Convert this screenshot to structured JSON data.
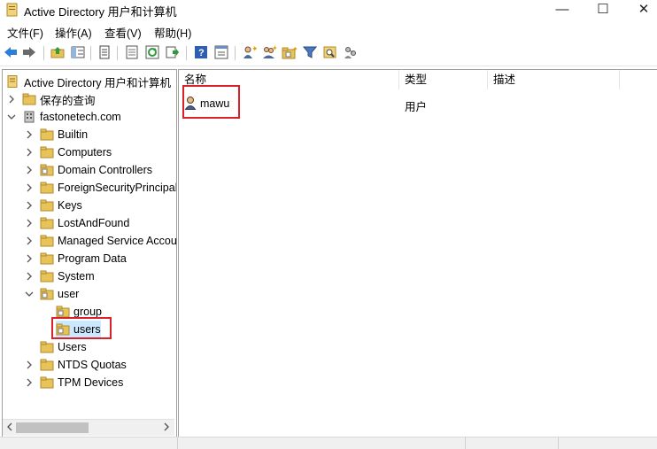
{
  "window": {
    "title": "Active Directory 用户和计算机",
    "controls": {
      "minimize": "—",
      "maximize": "☐",
      "close": "✕"
    }
  },
  "menu": [
    "文件(F)",
    "操作(A)",
    "查看(V)",
    "帮助(H)"
  ],
  "toolbar": {
    "icons": [
      "back-arrow-icon",
      "forward-arrow-icon",
      "up-folder-icon",
      "show-tree-icon",
      "copy-icon",
      "export-list-icon",
      "refresh-icon",
      "export-icon",
      "help-icon",
      "properties-icon",
      "new-user-icon",
      "new-group-icon",
      "new-ou-icon",
      "filter-icon",
      "find-icon",
      "delegate-icon"
    ]
  },
  "tree": {
    "root": "Active Directory 用户和计算机",
    "saved_queries": "保存的查询",
    "domain": "fastonetech.com",
    "children": [
      "Builtin",
      "Computers",
      "Domain Controllers",
      "ForeignSecurityPrincipals",
      "Keys",
      "LostAndFound",
      "Managed Service Accounts",
      "Program Data",
      "System",
      "user",
      "Users",
      "NTDS Quotas",
      "TPM Devices"
    ],
    "user_children": [
      "group",
      "users"
    ]
  },
  "list": {
    "columns": [
      "名称",
      "类型",
      "描述"
    ],
    "rows": [
      {
        "name": "mawu",
        "type": "用户",
        "description": ""
      }
    ]
  },
  "colors": {
    "highlight": "#d9212b",
    "folder": "#e8c35a",
    "folder_dark": "#c89a2c"
  }
}
